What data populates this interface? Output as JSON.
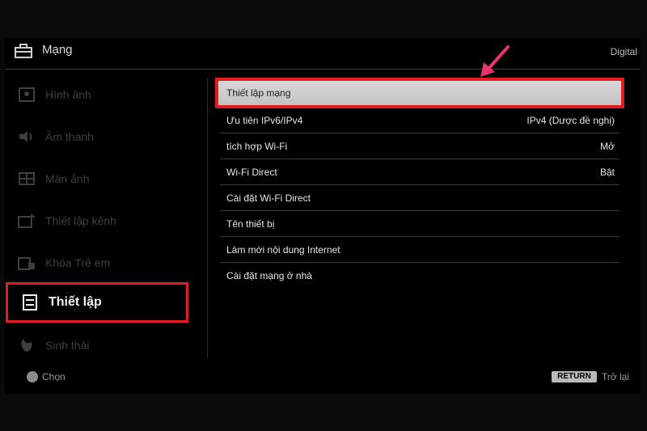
{
  "header": {
    "title": "Mạng",
    "source": "Digital",
    "title_icon": "toolbox-icon"
  },
  "sidebar": {
    "items": [
      {
        "label": "Hình ảnh",
        "icon": "picture-icon"
      },
      {
        "label": "Âm thanh",
        "icon": "speaker-icon"
      },
      {
        "label": "Màn ảnh",
        "icon": "screen-icon"
      },
      {
        "label": "Thiết lập kênh",
        "icon": "channel-icon"
      },
      {
        "label": "Khóa Trẻ em",
        "icon": "lock-icon"
      },
      {
        "label": "Thiết lập",
        "icon": "settings-icon",
        "active": true
      },
      {
        "label": "Sinh thái",
        "icon": "leaf-icon"
      }
    ]
  },
  "menu": {
    "rows": [
      {
        "label": "Thiết lập mạng",
        "value": "",
        "selected": true
      },
      {
        "label": "Ưu tiên IPv6/IPv4",
        "value": "IPv4 (Dược đề nghị)"
      },
      {
        "label": "tích hợp Wi-Fi",
        "value": "Mở"
      },
      {
        "label": "Wi-Fi Direct",
        "value": "Bật"
      },
      {
        "label": "Cài đặt Wi-Fi Direct",
        "value": ""
      },
      {
        "label": "Tên thiết bị",
        "value": ""
      },
      {
        "label": "Làm mới nội dung Internet",
        "value": ""
      },
      {
        "label": "Cài đặt mạng ở nhà",
        "value": ""
      }
    ]
  },
  "footer": {
    "ok_label": "Chọn",
    "return_key": "RETURN",
    "back_label": "Trở lại"
  },
  "colors": {
    "highlight": "#e31b23",
    "background": "#000000",
    "annotation_arrow": "#e8336d"
  }
}
